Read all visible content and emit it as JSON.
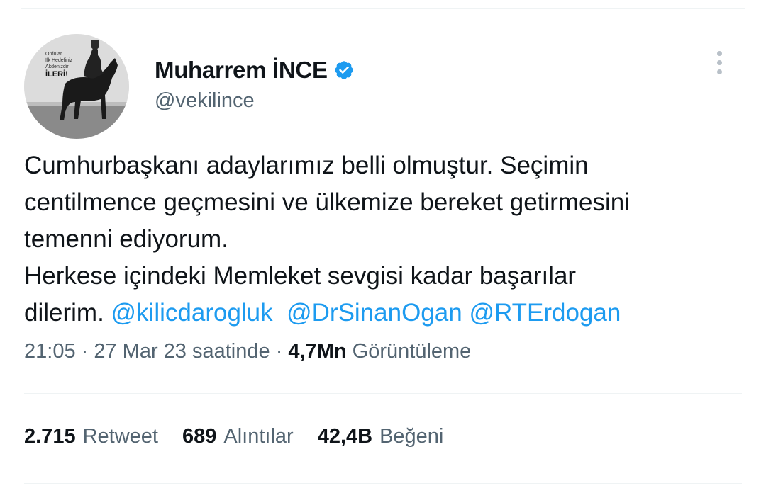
{
  "author": {
    "display_name": "Muharrem İNCE",
    "handle": "@vekilince",
    "avatar_caption": [
      "Ordular",
      "İlk Hedefiniz",
      "Akdenizdir",
      "İLERİ!"
    ]
  },
  "tweet": {
    "lines": [
      [
        {
          "text": "Cumhurbaşkanı adaylarımız belli olmuştur. Seçimin"
        }
      ],
      [
        {
          "text": "centilmence geçmesini ve ülkemize bereket getirmesini"
        }
      ],
      [
        {
          "text": "temenni ediyorum."
        }
      ],
      [
        {
          "text": "Herkese içindeki Memleket sevgisi kadar başarılar"
        }
      ],
      [
        {
          "text": "dilerim. "
        },
        {
          "text": "@kilicdarogluk",
          "mention": true
        },
        {
          "text": "  "
        },
        {
          "text": "@DrSinanOgan",
          "mention": true
        },
        {
          "text": " "
        },
        {
          "text": "@RTErdogan",
          "mention": true
        }
      ]
    ]
  },
  "meta": {
    "time": "21:05",
    "sep1": " · ",
    "date": "27 Mar 23 saatinde",
    "sep2": " · ",
    "views": "4,7Mn",
    "views_label": " Görüntüleme"
  },
  "stats": [
    {
      "value": "2.715",
      "label": "Retweet"
    },
    {
      "value": "689",
      "label": "Alıntılar"
    },
    {
      "value": "42,4B",
      "label": "Beğeni"
    }
  ],
  "icons": {
    "verified": "verified-badge-icon",
    "more": "more-options-icon"
  },
  "colors": {
    "mention": "#1d9bf0",
    "secondary": "#536471",
    "primary": "#0f1419",
    "verified": "#1d9bf0"
  }
}
